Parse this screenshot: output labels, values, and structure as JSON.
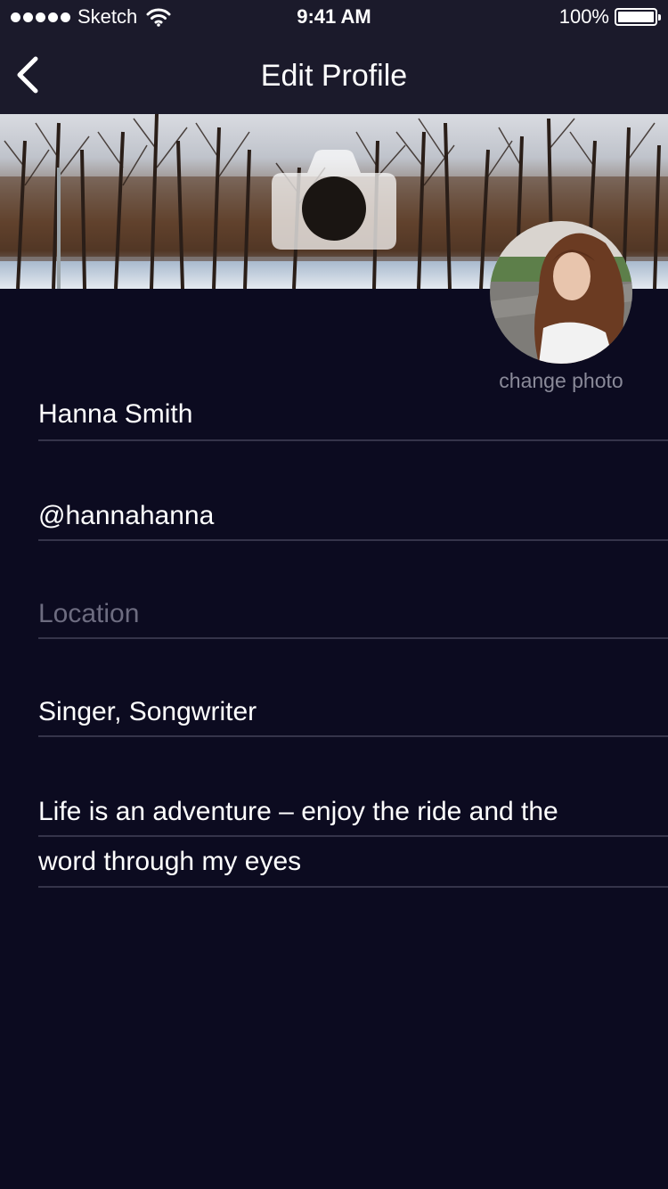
{
  "status_bar": {
    "carrier": "Sketch",
    "time": "9:41 AM",
    "battery": "100%",
    "icons": [
      "signal-dots-icon",
      "wifi-icon",
      "battery-icon"
    ]
  },
  "nav": {
    "title": "Edit Profile",
    "back_icon": "chevron-left-icon"
  },
  "cover": {
    "camera_icon": "camera-icon"
  },
  "avatar": {
    "change_photo_label": "change photo"
  },
  "form": {
    "name": "Hanna Smith",
    "username": "@hannahanna",
    "location_placeholder": "Location",
    "occupation": "Singer, Songwriter",
    "bio_line1": "Life is an adventure – enjoy the ride and the",
    "bio_line2": "word through my eyes"
  },
  "colors": {
    "background": "#0c0b20",
    "bar": "#1b1a2b",
    "divider": "#35344a",
    "placeholder": "#6d6c80",
    "secondary_text": "#8a8a99"
  }
}
